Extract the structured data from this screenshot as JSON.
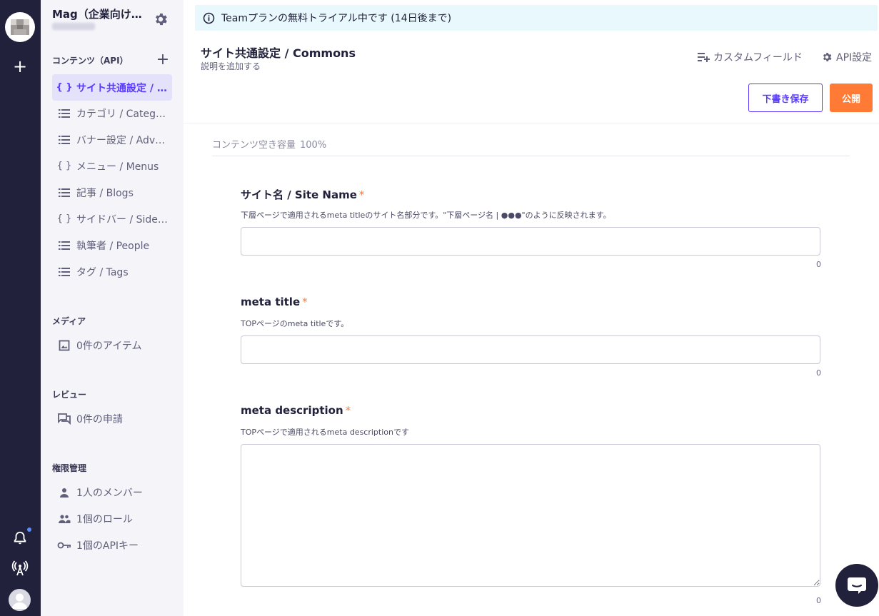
{
  "sidebar": {
    "workspace_title": "Mag（企業向け…",
    "sections": {
      "contents": "コンテンツ（API）",
      "media": "メディア",
      "review": "レビュー",
      "permissions": "権限管理"
    },
    "content_items": [
      {
        "label": "サイト共通設定 / …",
        "icon": "braces-icon",
        "active": true
      },
      {
        "label": "カテゴリ / Categ…",
        "icon": "list-icon"
      },
      {
        "label": "バナー設定 / Adv…",
        "icon": "list-icon"
      },
      {
        "label": "メニュー / Menus",
        "icon": "braces-icon"
      },
      {
        "label": "記事 / Blogs",
        "icon": "list-icon"
      },
      {
        "label": "サイドバー / Side…",
        "icon": "braces-icon"
      },
      {
        "label": "執筆者 / People",
        "icon": "list-icon"
      },
      {
        "label": "タグ / Tags",
        "icon": "list-icon"
      }
    ],
    "media_item": {
      "label": "0件のアイテム",
      "icon": "image-icon"
    },
    "review_item": {
      "label": "0件の申請",
      "icon": "comments-icon"
    },
    "permission_items": [
      {
        "label": "1人のメンバー",
        "icon": "person-icon"
      },
      {
        "label": "1個のロール",
        "icon": "people-icon"
      },
      {
        "label": "1個のAPIキー",
        "icon": "key-icon"
      }
    ]
  },
  "banner": {
    "text": "Teamプランの無料トライアル中です (14日後まで)"
  },
  "header": {
    "title": "サイト共通設定 / Commons",
    "description": "説明を追加する",
    "custom_fields_link": "カスタムフィールド",
    "api_settings_link": "API設定"
  },
  "actions": {
    "save_draft": "下書き保存",
    "publish": "公開"
  },
  "capacity": {
    "label": "コンテンツ空き容量",
    "value": "100%"
  },
  "fields": [
    {
      "label": "サイト名 / Site Name",
      "required_mark": "*",
      "help": "下層ページで適用されるmeta titleのサイト名部分です。\"下層ページ名 | ●●●\"のように反映されます。",
      "value": "",
      "count": "0"
    },
    {
      "label": "meta title",
      "required_mark": "*",
      "help": "TOPページのmeta titleです。",
      "value": "",
      "count": "0"
    },
    {
      "label": "meta description",
      "required_mark": "*",
      "help": "TOPページで適用されるmeta descriptionです",
      "value": "",
      "count": "0"
    }
  ],
  "colors": {
    "rail": "#21213b",
    "sidebar": "#f4f4f9",
    "accent": "#563bff",
    "publish": "#ff7a35",
    "banner": "#e9f8fc"
  }
}
